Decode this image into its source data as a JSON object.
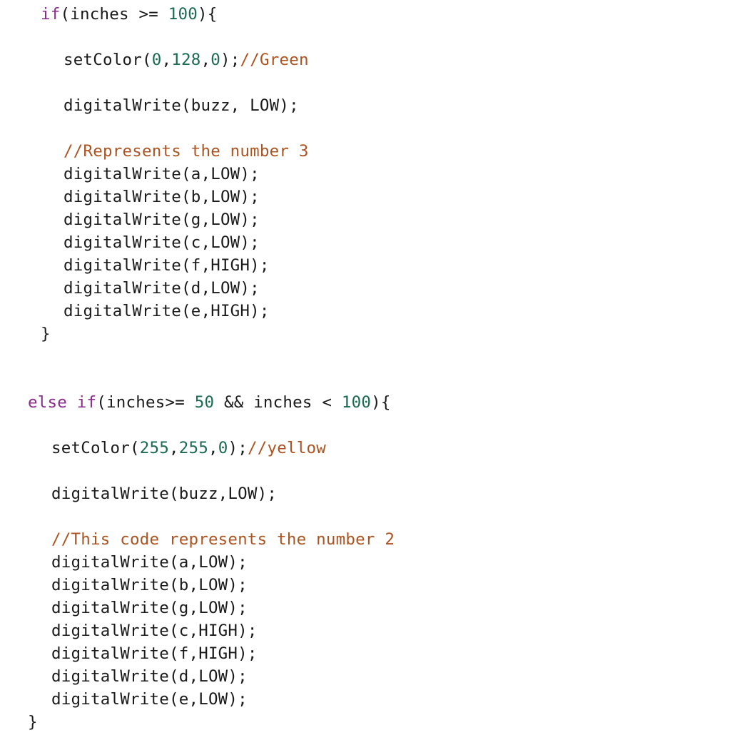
{
  "editor": {
    "language": "arduino-c",
    "background_color": "#ffffff",
    "colors": {
      "keyword": "#8a2a8a",
      "number": "#1a6b4f",
      "comment": "#ad5321",
      "plain": "#1a1a1a"
    }
  },
  "code": {
    "lines": [
      {
        "id": "line-if-inches-ge-100",
        "indent": "head-a",
        "gap": 0,
        "tokens": [
          {
            "t": "keyword",
            "s": "if"
          },
          {
            "t": "plain",
            "s": "(inches >= "
          },
          {
            "t": "number",
            "s": "100"
          },
          {
            "t": "plain",
            "s": "){"
          }
        ]
      },
      {
        "id": "line-setcolor-green",
        "indent": "body-a",
        "gap": 1,
        "tokens": [
          {
            "t": "plain",
            "s": "setColor("
          },
          {
            "t": "number",
            "s": "0"
          },
          {
            "t": "plain",
            "s": ","
          },
          {
            "t": "number",
            "s": "128"
          },
          {
            "t": "plain",
            "s": ","
          },
          {
            "t": "number",
            "s": "0"
          },
          {
            "t": "plain",
            "s": ");"
          },
          {
            "t": "comment",
            "s": "//Green"
          }
        ]
      },
      {
        "id": "line-buzz-low-1",
        "indent": "body-a",
        "gap": 1,
        "tokens": [
          {
            "t": "plain",
            "s": "digitalWrite(buzz, LOW);"
          }
        ]
      },
      {
        "id": "line-comment-number-3",
        "indent": "body-a",
        "gap": 1,
        "tokens": [
          {
            "t": "comment",
            "s": "//Represents the number 3"
          }
        ]
      },
      {
        "id": "line-a-low-1",
        "indent": "body-a",
        "gap": 0,
        "tokens": [
          {
            "t": "plain",
            "s": "digitalWrite(a,LOW);"
          }
        ]
      },
      {
        "id": "line-b-low-1",
        "indent": "body-a",
        "gap": 0,
        "tokens": [
          {
            "t": "plain",
            "s": "digitalWrite(b,LOW);"
          }
        ]
      },
      {
        "id": "line-g-low-1",
        "indent": "body-a",
        "gap": 0,
        "tokens": [
          {
            "t": "plain",
            "s": "digitalWrite(g,LOW);"
          }
        ]
      },
      {
        "id": "line-c-low-1",
        "indent": "body-a",
        "gap": 0,
        "tokens": [
          {
            "t": "plain",
            "s": "digitalWrite(c,LOW);"
          }
        ]
      },
      {
        "id": "line-f-high-1",
        "indent": "body-a",
        "gap": 0,
        "tokens": [
          {
            "t": "plain",
            "s": "digitalWrite(f,HIGH);"
          }
        ]
      },
      {
        "id": "line-d-low-1",
        "indent": "body-a",
        "gap": 0,
        "tokens": [
          {
            "t": "plain",
            "s": "digitalWrite(d,LOW);"
          }
        ]
      },
      {
        "id": "line-e-high-1",
        "indent": "body-a",
        "gap": 0,
        "tokens": [
          {
            "t": "plain",
            "s": "digitalWrite(e,HIGH);"
          }
        ]
      },
      {
        "id": "line-close-brace-1",
        "indent": "head-a",
        "gap": 0,
        "tokens": [
          {
            "t": "plain",
            "s": "}"
          }
        ]
      },
      {
        "id": "line-else-if-inches-50-100",
        "indent": "head-b",
        "gap": 2,
        "tokens": [
          {
            "t": "keyword",
            "s": "else if"
          },
          {
            "t": "plain",
            "s": "(inches>= "
          },
          {
            "t": "number",
            "s": "50"
          },
          {
            "t": "plain",
            "s": " && inches < "
          },
          {
            "t": "number",
            "s": "100"
          },
          {
            "t": "plain",
            "s": "){"
          }
        ]
      },
      {
        "id": "line-setcolor-yellow",
        "indent": "body-b",
        "gap": 1,
        "tokens": [
          {
            "t": "plain",
            "s": "setColor("
          },
          {
            "t": "number",
            "s": "255"
          },
          {
            "t": "plain",
            "s": ","
          },
          {
            "t": "number",
            "s": "255"
          },
          {
            "t": "plain",
            "s": ","
          },
          {
            "t": "number",
            "s": "0"
          },
          {
            "t": "plain",
            "s": ");"
          },
          {
            "t": "comment",
            "s": "//yellow"
          }
        ]
      },
      {
        "id": "line-buzz-low-2",
        "indent": "body-b",
        "gap": 1,
        "tokens": [
          {
            "t": "plain",
            "s": "digitalWrite(buzz,LOW);"
          }
        ]
      },
      {
        "id": "line-comment-number-2",
        "indent": "body-b",
        "gap": 1,
        "tokens": [
          {
            "t": "comment",
            "s": "//This code represents the number 2"
          }
        ]
      },
      {
        "id": "line-a-low-2",
        "indent": "body-b",
        "gap": 0,
        "tokens": [
          {
            "t": "plain",
            "s": "digitalWrite(a,LOW);"
          }
        ]
      },
      {
        "id": "line-b-low-2",
        "indent": "body-b",
        "gap": 0,
        "tokens": [
          {
            "t": "plain",
            "s": "digitalWrite(b,LOW);"
          }
        ]
      },
      {
        "id": "line-g-low-2",
        "indent": "body-b",
        "gap": 0,
        "tokens": [
          {
            "t": "plain",
            "s": "digitalWrite(g,LOW);"
          }
        ]
      },
      {
        "id": "line-c-high-2",
        "indent": "body-b",
        "gap": 0,
        "tokens": [
          {
            "t": "plain",
            "s": "digitalWrite(c,HIGH);"
          }
        ]
      },
      {
        "id": "line-f-high-2",
        "indent": "body-b",
        "gap": 0,
        "tokens": [
          {
            "t": "plain",
            "s": "digitalWrite(f,HIGH);"
          }
        ]
      },
      {
        "id": "line-d-low-2",
        "indent": "body-b",
        "gap": 0,
        "tokens": [
          {
            "t": "plain",
            "s": "digitalWrite(d,LOW);"
          }
        ]
      },
      {
        "id": "line-e-low-2",
        "indent": "body-b",
        "gap": 0,
        "tokens": [
          {
            "t": "plain",
            "s": "digitalWrite(e,LOW);"
          }
        ]
      },
      {
        "id": "line-close-brace-2",
        "indent": "head-b",
        "gap": 0,
        "tokens": [
          {
            "t": "plain",
            "s": "}"
          }
        ]
      }
    ]
  }
}
